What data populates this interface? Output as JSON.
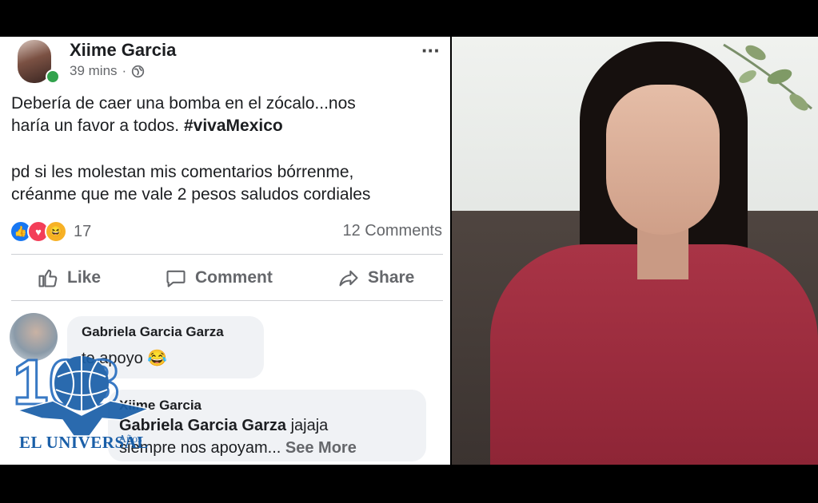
{
  "post": {
    "author": "Xiime Garcia",
    "time": "39 mins",
    "separator": "·",
    "more_icon": "···",
    "text_line1": "Debería de caer una bomba en el zócalo...nos",
    "text_line2_prefix": "haría un favor a todos. ",
    "hashtag": "#vivaMexico",
    "text_line3": "pd si les molestan mis comentarios bórrenme,",
    "text_line4": "créanme que me vale 2 pesos  saludos cordiales",
    "reaction_count": "17",
    "comments_count": "12 Comments",
    "actions": {
      "like": "Like",
      "comment": "Comment",
      "share": "Share"
    }
  },
  "comments": [
    {
      "name": "Gabriela Garcia Garza",
      "text": "te apoyo 😂"
    },
    {
      "name": "Xiime Garcia",
      "mention": "Gabriela Garcia Garza",
      "text_suffix": " jajaja",
      "text_line2": "siempre nos apoyam...",
      "see_more": "See More"
    }
  ],
  "watermark": {
    "number": "103",
    "years": "Años",
    "brand": "EL UNIVERSAL"
  },
  "colors": {
    "brand_blue": "#1a5fa8",
    "online_green": "#31a24c",
    "like_blue": "#1877f2",
    "love_red": "#f33e58",
    "haha_yellow": "#f7b125"
  }
}
